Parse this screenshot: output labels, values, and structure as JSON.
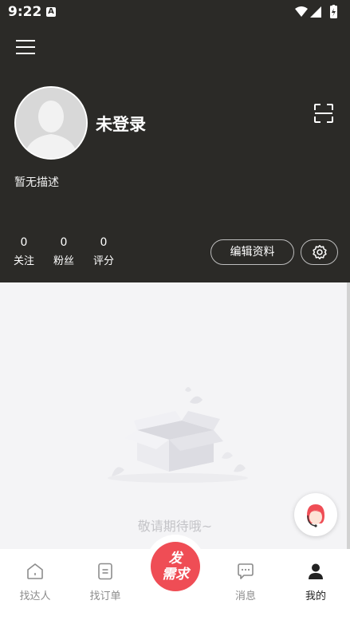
{
  "status_bar": {
    "time": "9:22",
    "a_icon": "A"
  },
  "profile": {
    "nickname": "未登录",
    "description": "暂无描述",
    "stats": [
      {
        "value": "0",
        "label": "关注"
      },
      {
        "value": "0",
        "label": "粉丝"
      },
      {
        "value": "0",
        "label": "评分"
      }
    ],
    "edit_label": "编辑资料"
  },
  "empty_state": {
    "text": "敬请期待哦~"
  },
  "tabbar": {
    "tabs": [
      {
        "label": "找达人",
        "icon": "house-icon"
      },
      {
        "label": "找订单",
        "icon": "order-icon"
      },
      {
        "label": "消息",
        "icon": "message-icon"
      },
      {
        "label": "我的",
        "icon": "person-icon"
      }
    ],
    "publish_line1": "发",
    "publish_line2": "需求"
  },
  "colors": {
    "header_bg": "#2b2a27",
    "accent": "#ef4d55",
    "content_bg": "#f4f4f6"
  }
}
